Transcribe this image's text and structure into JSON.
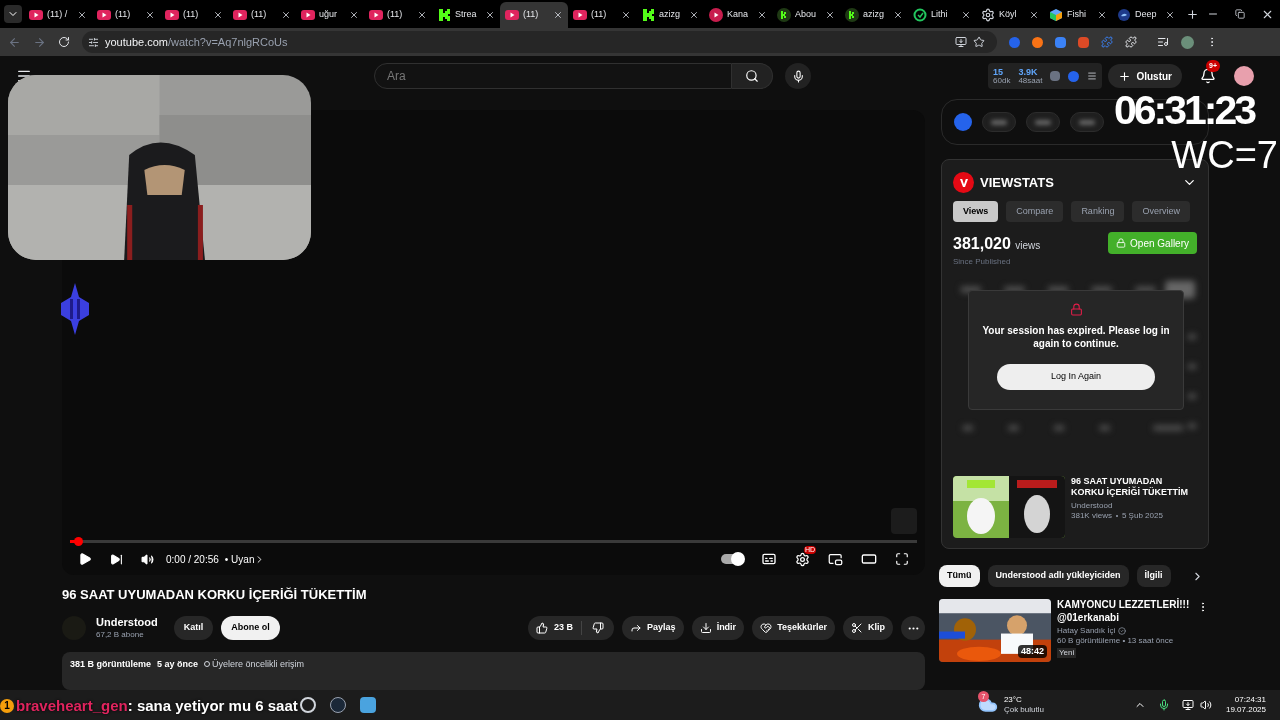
{
  "browser": {
    "tabs": [
      {
        "kind": "video",
        "title": "(11) /",
        "selected": false
      },
      {
        "kind": "video",
        "title": "(11)",
        "selected": false
      },
      {
        "kind": "video",
        "title": "(11)",
        "selected": false
      },
      {
        "kind": "video",
        "title": "(11)",
        "selected": false
      },
      {
        "kind": "video",
        "title": "uğur",
        "selected": false
      },
      {
        "kind": "video",
        "title": "(11)",
        "selected": false
      },
      {
        "kind": "stream",
        "title": "Strea",
        "selected": false
      },
      {
        "kind": "video",
        "title": "(11)",
        "selected": true
      },
      {
        "kind": "video",
        "title": "(11)",
        "selected": false
      },
      {
        "kind": "stream",
        "title": "azizg",
        "selected": false
      },
      {
        "kind": "channel",
        "title": "Kana",
        "selected": false
      },
      {
        "kind": "profile",
        "title": "Abou",
        "selected": false
      },
      {
        "kind": "profile",
        "title": "azizg",
        "selected": false
      },
      {
        "kind": "check",
        "title": "Lithi",
        "selected": false
      },
      {
        "kind": "settings",
        "title": "Köyl",
        "selected": false
      },
      {
        "kind": "game",
        "title": "Fishi",
        "selected": false
      },
      {
        "kind": "chat",
        "title": "Deep",
        "selected": false
      }
    ],
    "url_host": "youtube.com",
    "url_path": "/watch?v=Aq7nlgRCoUs"
  },
  "header": {
    "search_placeholder": "Ara",
    "stats": [
      {
        "value": "15",
        "label": "60dk"
      },
      {
        "value": "3.9K",
        "label": "48saat"
      }
    ],
    "create_label": "Olustur",
    "notifications": "9+"
  },
  "overlay": {
    "clock": "06:31:23",
    "counter": "WC=7",
    "chat": {
      "badge": "1",
      "user": "braveheart_gen",
      "message": ": sana yetiyor mu 6 saat"
    }
  },
  "player": {
    "level": 0.01,
    "time": "0:00 / 20:56",
    "chapter": "• Uyan",
    "autoplay": true,
    "quality_badge": "HD"
  },
  "video": {
    "title": "96 SAAT UYUMADAN KORKU İÇERİĞİ TÜKETTİM",
    "channel": "Understood",
    "subscribers": "67,2 B abone",
    "join": "Katıl",
    "subscribe": "Abone ol",
    "likes": "23 B",
    "actions": [
      {
        "kind": "share",
        "label": "Paylaş"
      },
      {
        "kind": "download",
        "label": "İndir"
      },
      {
        "kind": "thanks",
        "label": "Teşekkürler"
      },
      {
        "kind": "clip",
        "label": "Klip"
      }
    ],
    "views": "381 B görüntüleme",
    "age": "5 ay önce",
    "access": "Üyelere öncelikli erişim"
  },
  "viewstats": {
    "title": "VIEWSTATS",
    "tabs": [
      {
        "label": "Views",
        "selected": true
      },
      {
        "label": "Compare",
        "selected": false
      },
      {
        "label": "Ranking",
        "selected": false
      },
      {
        "label": "Overview",
        "selected": false
      }
    ],
    "count": "381,020",
    "count_unit": "views",
    "since": "Since Published",
    "gallery": "Open Gallery",
    "dialog": {
      "message": "Your session has expired. Please log in again to continue.",
      "button": "Log In Again"
    },
    "video": {
      "title": "96 SAAT UYUMADAN KORKU İÇERİĞİ TÜKETTİM",
      "channel": "Understood",
      "views": "381K views",
      "date": "5 Şub 2025"
    }
  },
  "chips": [
    {
      "label": "Tümü",
      "selected": true
    },
    {
      "label": "Understood adlı yükleyiciden",
      "selected": false
    },
    {
      "label": "İlgili",
      "selected": false
    }
  ],
  "recommendations": [
    {
      "title": "KAMYONCU LEZZETLERİ!!! @01erkanabi",
      "channel": "Hatay Sandık İçi",
      "verified": true,
      "meta": "60 B görüntüleme • 13 saat önce",
      "badge": "Yeni",
      "duration": "48:42"
    }
  ],
  "taskbar": {
    "weather_badge": "7",
    "temperature": "23°C",
    "condition": "Çok bulutlu",
    "time": "07:24:31",
    "date": "19.07.2025"
  }
}
